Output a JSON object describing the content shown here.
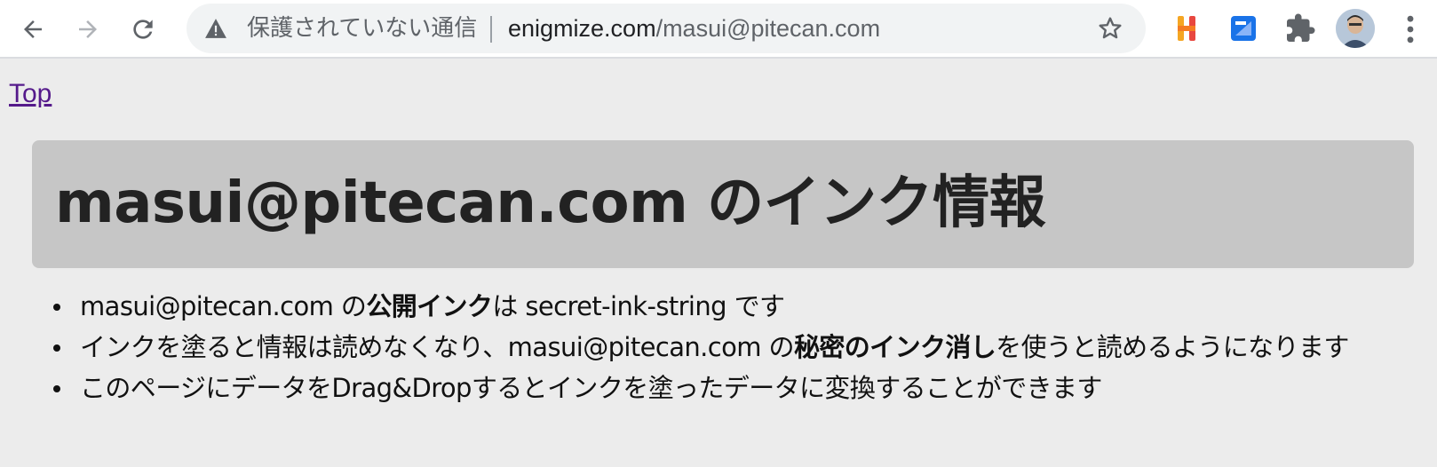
{
  "browser": {
    "security_label": "保護されていない通信",
    "url_host": "enigmize.com",
    "url_path": "/masui@pitecan.com",
    "icons": {
      "back": "arrow-left-icon",
      "forward": "arrow-right-icon",
      "reload": "reload-icon",
      "warning": "warning-triangle-icon",
      "bookmark": "star-icon",
      "extension_1": "h-extension-icon",
      "extension_2": "blue-extension-icon",
      "extensions": "puzzle-icon",
      "menu": "kebab-menu-icon"
    }
  },
  "page": {
    "top_link": "Top",
    "heading": "masui@pitecan.com のインク情報",
    "items": [
      {
        "p1": "masui@pitecan.com の",
        "b1": "公開インク",
        "p2": "は secret-ink-string です"
      },
      {
        "p1": "インクを塗ると情報は読めなくなり、masui@pitecan.com の",
        "b1": "秘密のインク消し",
        "p2": "を使うと読めるようになります"
      },
      {
        "p1": "このページにデータをDrag&Dropするとインクを塗ったデータに変換することができます"
      }
    ]
  },
  "colors": {
    "background": "#ececec",
    "heading_box": "#c6c6c6",
    "link": "#551a8b"
  }
}
